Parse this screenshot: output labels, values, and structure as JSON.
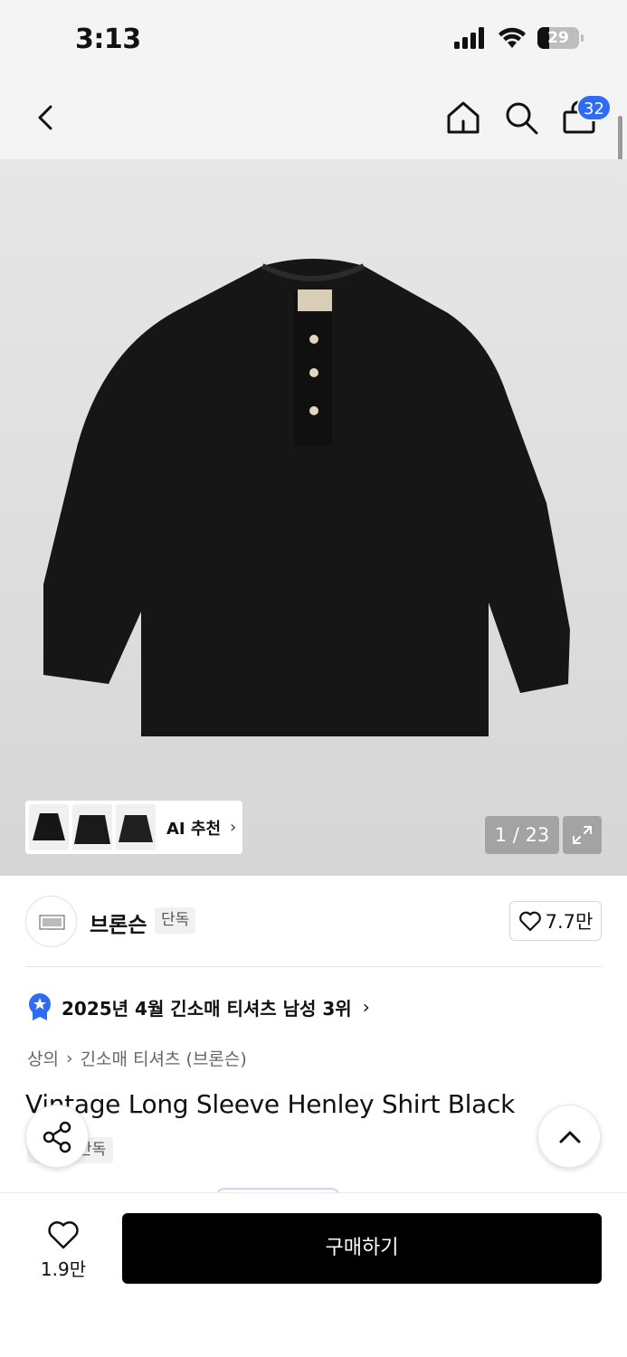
{
  "status_bar": {
    "time": "3:13",
    "battery_level": "29",
    "battery_fraction": 0.29
  },
  "nav": {
    "cart_badge": "32",
    "icons": [
      "chevron-left-icon",
      "home-icon",
      "search-icon",
      "cart-icon"
    ]
  },
  "gallery": {
    "ai_label": "AI 추천",
    "counter": "1 / 23"
  },
  "brand": {
    "name": "브론슨",
    "tag": "단독",
    "like_count": "7.7만"
  },
  "ranking": {
    "text": "2025년 4월 긴소매 티셔츠 남성 3위"
  },
  "breadcrumb": {
    "category": "상의",
    "subcategory": "긴소매 티셔츠 (브론슨)"
  },
  "product": {
    "title": "Vintage Long Sleeve Henley Shirt Black",
    "exclusive_tag": "단독"
  },
  "bottom_bar": {
    "wish_count": "1.9만",
    "buy_label": "구매하기"
  },
  "colors": {
    "accent": "#2e6cf6",
    "buy_button": "#000000"
  }
}
